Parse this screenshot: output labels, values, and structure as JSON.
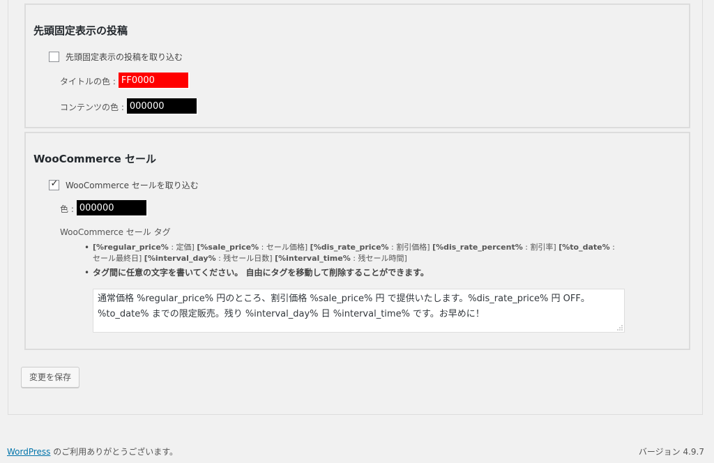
{
  "sticky_section": {
    "title": "先頭固定表示の投稿",
    "checkbox_label": "先頭固定表示の投稿を取り込む",
    "checkbox_checked": false,
    "title_color_label": "タイトルの色 :",
    "title_color_value": "FF0000",
    "title_color_hex": "#ff0000",
    "content_color_label": "コンテンツの色 :",
    "content_color_value": "000000",
    "content_color_hex": "#000000"
  },
  "woo_section": {
    "title": "WooCommerce セール",
    "checkbox_label": "WooCommerce セールを取り込む",
    "checkbox_checked": true,
    "color_label": "色 :",
    "color_value": "000000",
    "color_hex": "#000000",
    "tag_heading": "WooCommerce セール タグ",
    "tags": [
      {
        "tag": "[%regular_price%",
        "desc": " : 定価] "
      },
      {
        "tag": "[%sale_price%",
        "desc": " : セール価格] "
      },
      {
        "tag": "[%dis_rate_price%",
        "desc": " : 割引価格] "
      },
      {
        "tag": "[%dis_rate_percent%",
        "desc": " : 割引率] "
      },
      {
        "tag": "[%to_date%",
        "desc": " : セール最終日] "
      },
      {
        "tag": "[%interval_day%",
        "desc": " : 残セール日数] "
      },
      {
        "tag": "[%interval_time%",
        "desc": " : 残セール時間]"
      }
    ],
    "note": "タグ間に任意の文字を書いてください。 自由にタグを移動して削除することができます。",
    "template_text": "通常価格 %regular_price% 円のところ、割引価格 %sale_price% 円 で提供いたします。%dis_rate_price% 円 OFF。%to_date% までの限定販売。残り %interval_day% 日 %interval_time% です。お早めに！"
  },
  "save_button": "変更を保存",
  "footer": {
    "wp_link": "WordPress",
    "thanks": " のご利用ありがとうございます。",
    "version": "バージョン 4.9.7"
  }
}
